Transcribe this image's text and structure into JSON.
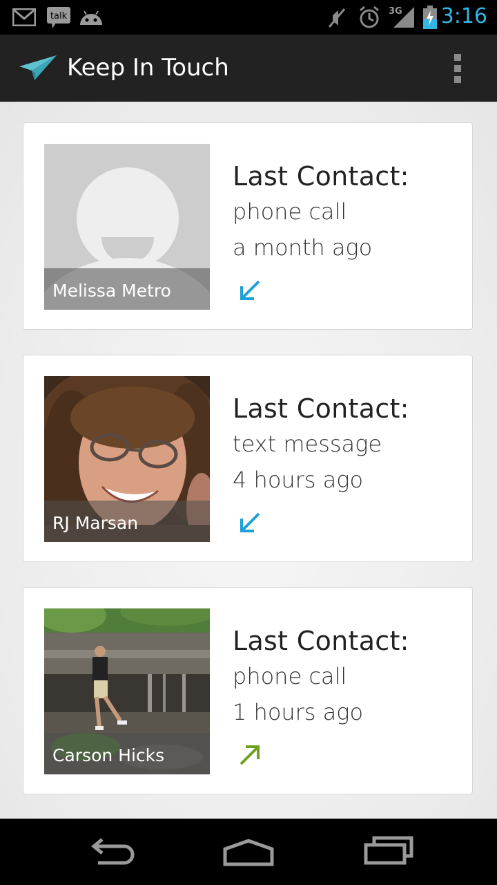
{
  "status_bar": {
    "notification_icons": [
      "gmail-icon",
      "talk-icon",
      "android-icon"
    ],
    "talk_badge_text": "talk",
    "system_icons": [
      "mute-icon",
      "alarm-icon",
      "signal-3g-icon",
      "battery-charging-icon"
    ],
    "network_label": "3G",
    "time": "3:16"
  },
  "action_bar": {
    "app_icon": "paper-plane-icon",
    "title": "Keep In Touch",
    "overflow_icon": "overflow-menu-icon"
  },
  "contacts": [
    {
      "name": "Melissa Metro",
      "heading": "Last Contact:",
      "method": "phone call",
      "when": "a month ago",
      "direction": "incoming",
      "direction_icon": "arrow-down-left-icon",
      "direction_color": "#1e9fd7",
      "photo": "default-avatar"
    },
    {
      "name": "RJ Marsan",
      "heading": "Last Contact:",
      "method": "text message",
      "when": "4 hours ago",
      "direction": "incoming",
      "direction_icon": "arrow-down-left-icon",
      "direction_color": "#1e9fd7",
      "photo": "portrait-photo"
    },
    {
      "name": "Carson Hicks",
      "heading": "Last Contact:",
      "method": "phone call",
      "when": "1 hours ago",
      "direction": "outgoing",
      "direction_icon": "arrow-up-right-icon",
      "direction_color": "#6ea01e",
      "photo": "waterfall-photo"
    }
  ],
  "nav_bar": {
    "buttons": [
      "back-icon",
      "home-icon",
      "recent-apps-icon"
    ]
  },
  "colors": {
    "accent": "#33b5e5",
    "action_bar": "#222222",
    "incoming": "#1e9fd7",
    "outgoing": "#6ea01e"
  }
}
